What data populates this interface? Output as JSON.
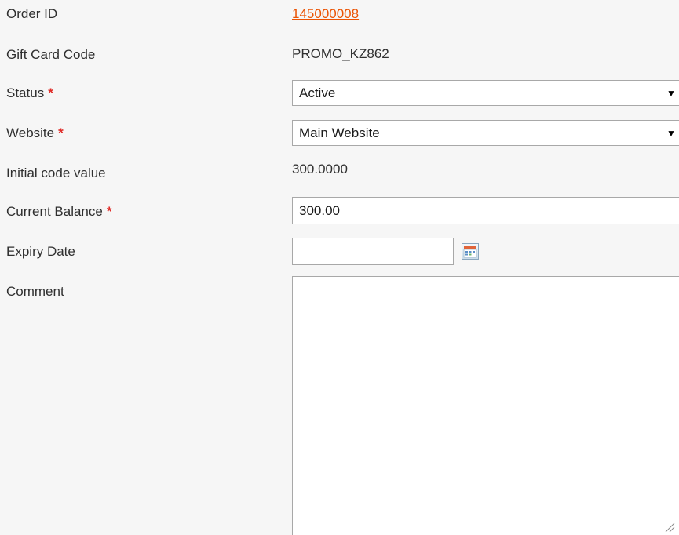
{
  "form": {
    "order_id": {
      "label": "Order ID",
      "value": "145000008"
    },
    "gift_card_code": {
      "label": "Gift Card Code",
      "value": "PROMO_KZ862"
    },
    "status": {
      "label": "Status",
      "required_mark": "*",
      "selected": "Active"
    },
    "website": {
      "label": "Website",
      "required_mark": "*",
      "selected": "Main Website"
    },
    "initial_code_value": {
      "label": "Initial code value",
      "value": "300.0000"
    },
    "current_balance": {
      "label": "Current Balance",
      "required_mark": "*",
      "value": "300.00"
    },
    "expiry_date": {
      "label": "Expiry Date",
      "value": "",
      "icon": "calendar-icon"
    },
    "comment": {
      "label": "Comment",
      "value": ""
    },
    "dropdown_arrow": "▼"
  },
  "colors": {
    "link": "#eb5202",
    "required": "#e02b27",
    "background": "#f6f6f6",
    "field_border": "#a8a8a8"
  }
}
